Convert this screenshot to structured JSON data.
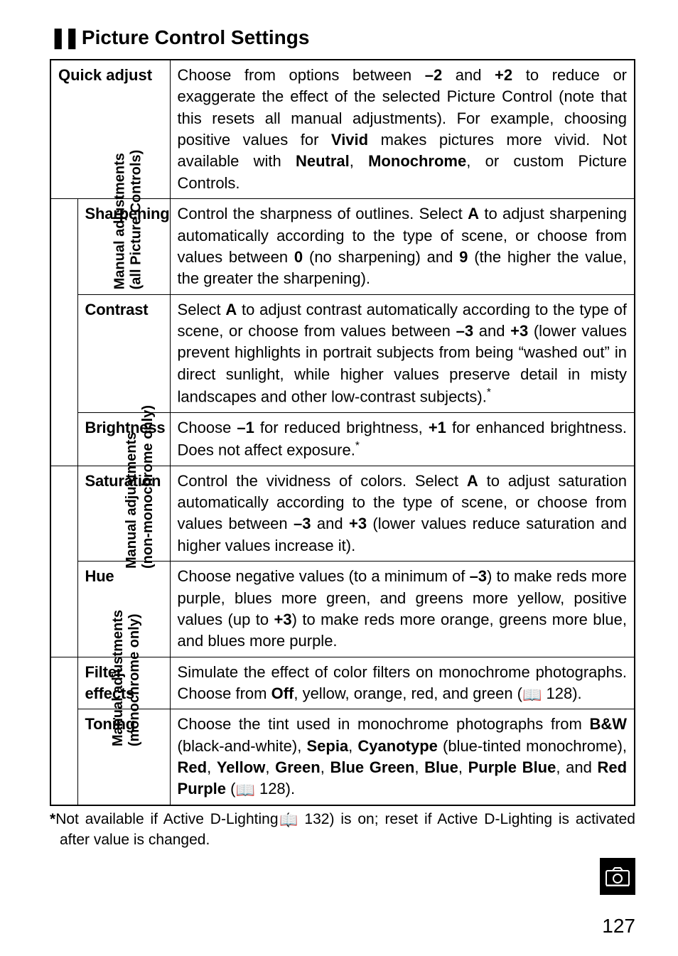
{
  "section_title_prefix": "❚❚",
  "section_title": "Picture Control Settings",
  "rows": {
    "quick_adjust": {
      "label": "Quick adjust",
      "body": "Choose from options between <b>–2</b> and <b>+2</b> to reduce or exaggerate the effect of the selected Picture Control (note that this resets all manual adjustments). For example, choosing positive values for <b>Vivid</b> makes pictures more vivid. Not available with <b>Neutral</b>, <b>Monochrome</b>, or custom Picture Controls."
    },
    "group_all": {
      "vlabel": "Manual adjustments<br>(all Picture Controls)",
      "sharpening": {
        "label": "Sharpening",
        "body": "Control the sharpness of outlines. Select <b>A</b> to adjust sharpening automatically according to the type of scene, or choose from values between <b>0</b> (no sharpening) and <b>9</b> (the higher the value, the greater the sharpening)."
      },
      "contrast": {
        "label": "Contrast",
        "body": "Select <b>A</b> to adjust contrast automatically according to the type of scene, or choose from values between <b>–3</b> and <b>+3</b> (lower values prevent highlights in portrait subjects from being “washed out” in direct sunlight, while higher values preserve detail in misty landscapes and other low-contrast subjects).<sup class='star'>*</sup>"
      },
      "brightness": {
        "label": "Brightness",
        "body": "Choose <b>–1</b> for reduced brightness, <b>+1</b> for enhanced brightness. Does not affect exposure.<sup class='star'>*</sup>"
      }
    },
    "group_nonmono": {
      "vlabel": "Manual adjustments<br>(non-monochrome only)",
      "saturation": {
        "label": "Saturation",
        "body": "Control the vividness of colors. Select <b>A</b> to adjust saturation automatically according to the type of scene, or choose from values between <b>–3</b> and <b>+3</b> (lower values reduce saturation and higher values increase it)."
      },
      "hue": {
        "label": "Hue",
        "body": "Choose negative values (to a minimum of <b>–3</b>) to make reds more purple, blues more green, and greens more yellow, positive values (up to <b>+3</b>) to make reds more orange, greens more blue, and blues more purple."
      }
    },
    "group_mono": {
      "vlabel": "Manual adjustments<br>(monochrome only)",
      "filter": {
        "label": "Filter effects",
        "body": "Simulate the effect of color filters on monochrome photographs. Choose from <b>Off</b>, yellow, orange, red, and green (<span class='book-icon'>📖</span> 128)."
      },
      "toning": {
        "label": "Toning",
        "body": "Choose the tint used in monochrome photographs from <b>B&amp;W</b> (black-and-white), <b>Sepia</b>, <b>Cyanotype</b> (blue-tinted monochrome), <b>Red</b>, <b>Yellow</b>, <b>Green</b>, <b>Blue Green</b>, <b>Blue</b>, <b>Purple Blue</b>, and <b>Red Purple</b> (<span class='book-icon'>📖</span> 128)."
      }
    }
  },
  "footnote": "<b>*</b>Not available if Active D-Lighting (<span class='book-icon'>📖</span> 132) is on; reset if Active D-Lighting is activated after value is changed.",
  "page_number": "127",
  "tab_icon_name": "camera-icon"
}
